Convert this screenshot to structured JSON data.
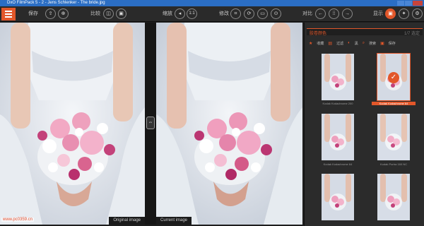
{
  "window": {
    "title": "DxO FilmPack 5 - 2 - Jens Schlenker - The bride.jpg"
  },
  "toolbar": {
    "save_label": "保存",
    "compare_label": "比较",
    "zoom_label": "缩放",
    "zoom_value": "1:1",
    "edit_label": "修改",
    "contrast_label": "对比",
    "display_label": "显示"
  },
  "panes": {
    "left_caption": "Original image",
    "right_caption": "Current image"
  },
  "panel": {
    "header_title": "胶卷颜色",
    "header_right": "1/7 选定",
    "filters": [
      "收藏",
      "过滤",
      "黑",
      "搜索",
      "保存"
    ],
    "thumbnails": [
      {
        "label": "Kodak Kodachrome 200",
        "selected": false
      },
      {
        "label": "Kodak Kodachrome 64",
        "selected": true
      },
      {
        "label": "Kodak Kodachrome 64",
        "selected": false
      },
      {
        "label": "Kodak Portra 160 NC",
        "selected": false
      },
      {
        "label": "",
        "selected": false
      },
      {
        "label": "",
        "selected": false
      }
    ]
  },
  "colors": {
    "accent": "#e2572a",
    "titlebar": "#2b6ec4"
  },
  "watermark": "www.pc0359.cn"
}
